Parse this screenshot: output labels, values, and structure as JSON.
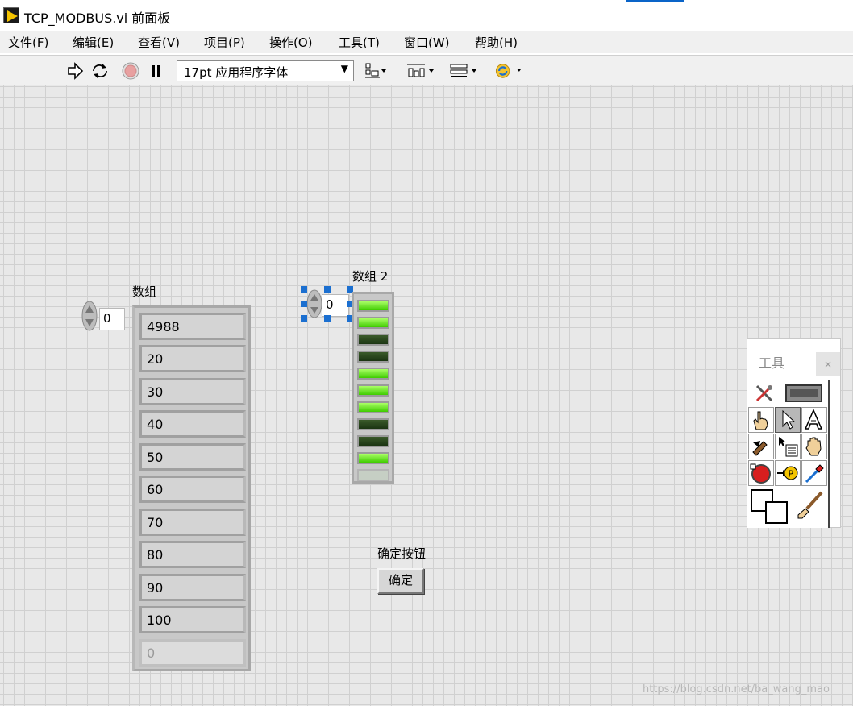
{
  "window": {
    "title": "TCP_MODBUS.vi 前面板"
  },
  "menu": [
    {
      "label": "文件(F)"
    },
    {
      "label": "编辑(E)"
    },
    {
      "label": "查看(V)"
    },
    {
      "label": "项目(P)"
    },
    {
      "label": "操作(O)"
    },
    {
      "label": "工具(T)"
    },
    {
      "label": "窗口(W)"
    },
    {
      "label": "帮助(H)"
    }
  ],
  "toolbar": {
    "font_select": "17pt 应用程序字体",
    "icons": [
      "run-arrow-icon",
      "run-continuously-icon",
      "abort-icon",
      "pause-icon",
      "align-objects-icon",
      "distribute-objects-icon",
      "resize-objects-icon",
      "reorder-icon"
    ]
  },
  "array1": {
    "label": "数组",
    "index": "0",
    "values": [
      "4988",
      "20",
      "30",
      "40",
      "50",
      "60",
      "70",
      "80",
      "90",
      "100",
      "0"
    ]
  },
  "array2": {
    "label": "数组 2",
    "index": "0",
    "leds": [
      true,
      true,
      false,
      false,
      true,
      true,
      true,
      false,
      false,
      true,
      null
    ]
  },
  "ok_control": {
    "label": "确定按钮",
    "button_text": "确定"
  },
  "tools_palette": {
    "title": "工具",
    "close": "×",
    "tools": [
      "automatic-tool-selection-icon",
      "operate-value-icon",
      "position-select-icon",
      "edit-text-icon",
      "connect-wire-icon",
      "object-shortcut-menu-icon",
      "scroll-window-icon",
      "breakpoint-icon",
      "probe-icon",
      "get-color-icon",
      "set-color-icon"
    ]
  },
  "colors": {
    "led_on": "#3fcc00",
    "led_off": "#1b3412",
    "selection": "#1b6fd0",
    "panel_bg": "#e8e8e8"
  },
  "watermark": "https://blog.csdn.net/ba_wang_mao"
}
